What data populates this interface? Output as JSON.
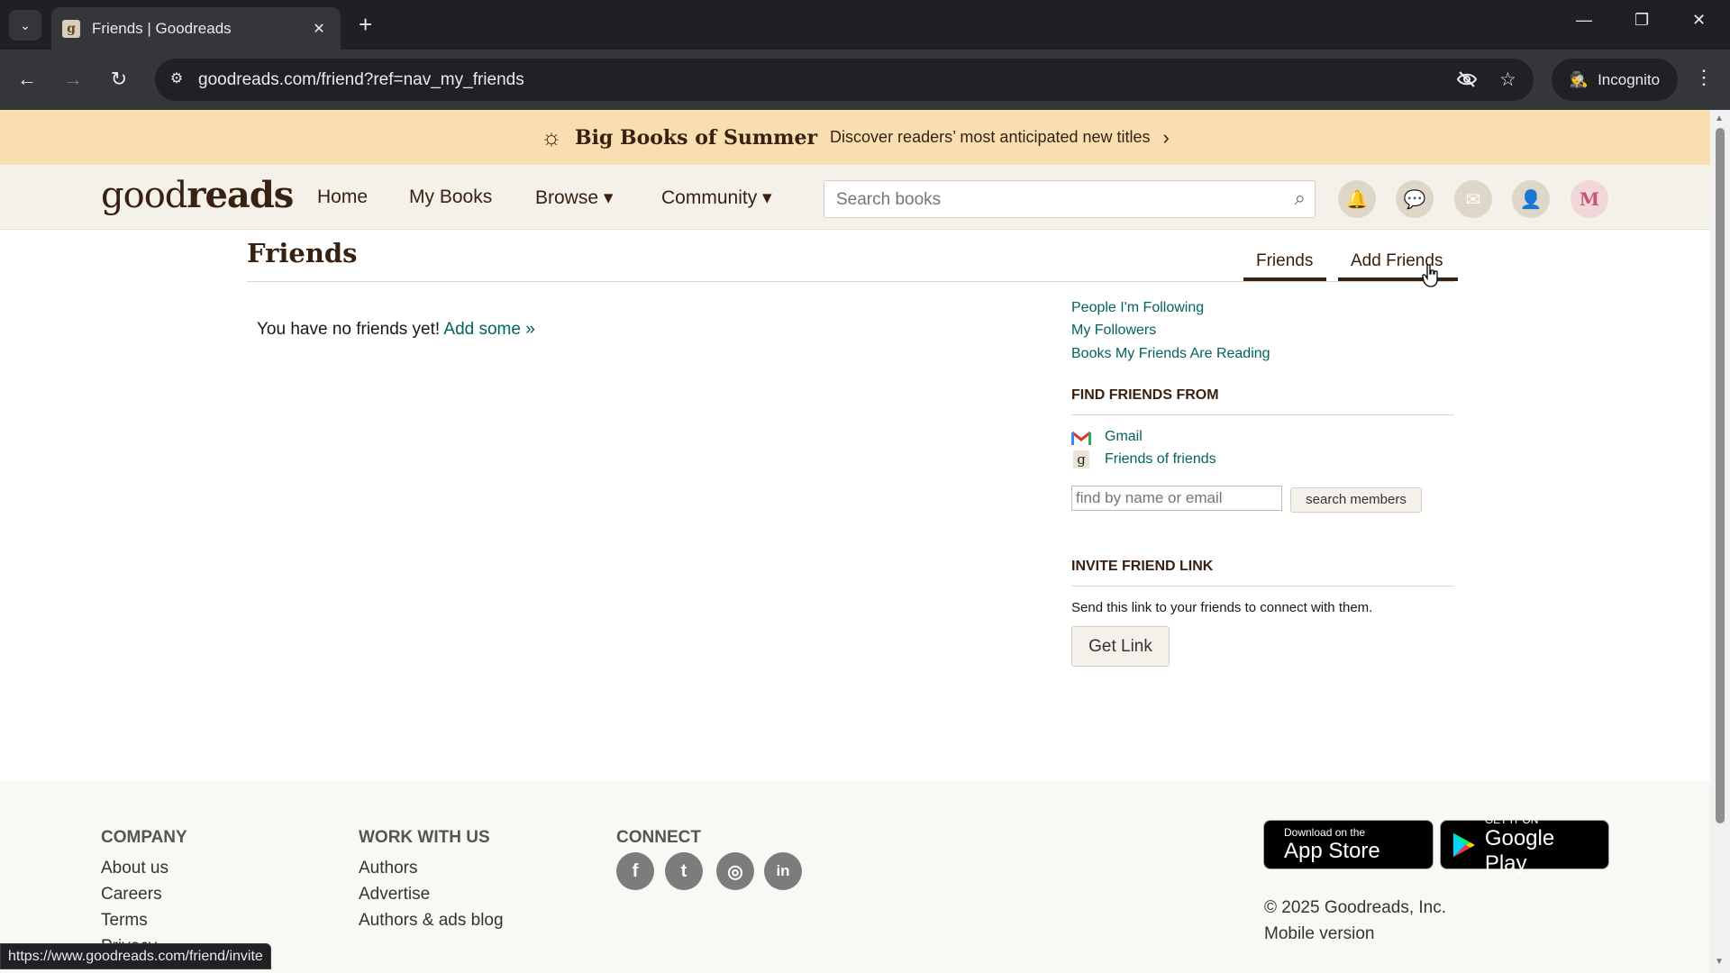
{
  "browser": {
    "tab_title": "Friends | Goodreads",
    "tab_favicon": "g",
    "url": "goodreads.com/friend?ref=nav_my_friends",
    "incognito_label": "Incognito",
    "status_url": "https://www.goodreads.com/friend/invite"
  },
  "banner": {
    "title": "Big Books of Summer",
    "text": "Discover readers’ most anticipated new titles",
    "icon": "sun-book-icon"
  },
  "header": {
    "logo_light": "good",
    "logo_bold": "reads",
    "nav": {
      "home": "Home",
      "my_books": "My Books",
      "browse": "Browse ▾",
      "community": "Community ▾"
    },
    "search_placeholder": "Search books",
    "avatar_letter": "M"
  },
  "main": {
    "title": "Friends",
    "tabs": {
      "friends": "Friends",
      "add_friends": "Add Friends"
    },
    "no_friends_text": "You have no friends yet! ",
    "add_some_link": "Add some »"
  },
  "sidebar": {
    "links": {
      "following": "People I'm Following",
      "followers": "My Followers",
      "reading": "Books My Friends Are Reading"
    },
    "find_friends_heading": "FIND FRIENDS FROM",
    "sources": {
      "gmail": "Gmail",
      "friends_of_friends": "Friends of friends"
    },
    "find_placeholder": "find by name or email",
    "search_button": "search members",
    "invite_heading": "INVITE FRIEND LINK",
    "invite_text": "Send this link to your friends to connect with them.",
    "get_link_button": "Get Link"
  },
  "footer": {
    "company": {
      "heading": "COMPANY",
      "about": "About us",
      "careers": "Careers",
      "terms": "Terms",
      "privacy": "Privacy"
    },
    "work": {
      "heading": "WORK WITH US",
      "authors": "Authors",
      "advertise": "Advertise",
      "blog": "Authors & ads blog"
    },
    "connect": {
      "heading": "CONNECT"
    },
    "app_store": {
      "small": "Download on the",
      "big": "App Store"
    },
    "google_play": {
      "small": "GET IT ON",
      "big": "Google Play"
    },
    "copyright": "© 2025 Goodreads, Inc.",
    "mobile": "Mobile version"
  },
  "colors": {
    "brand_brown": "#382110",
    "link_teal": "#00635d",
    "header_bg": "#f4f1ea",
    "banner_bg": "#f8deb0"
  }
}
